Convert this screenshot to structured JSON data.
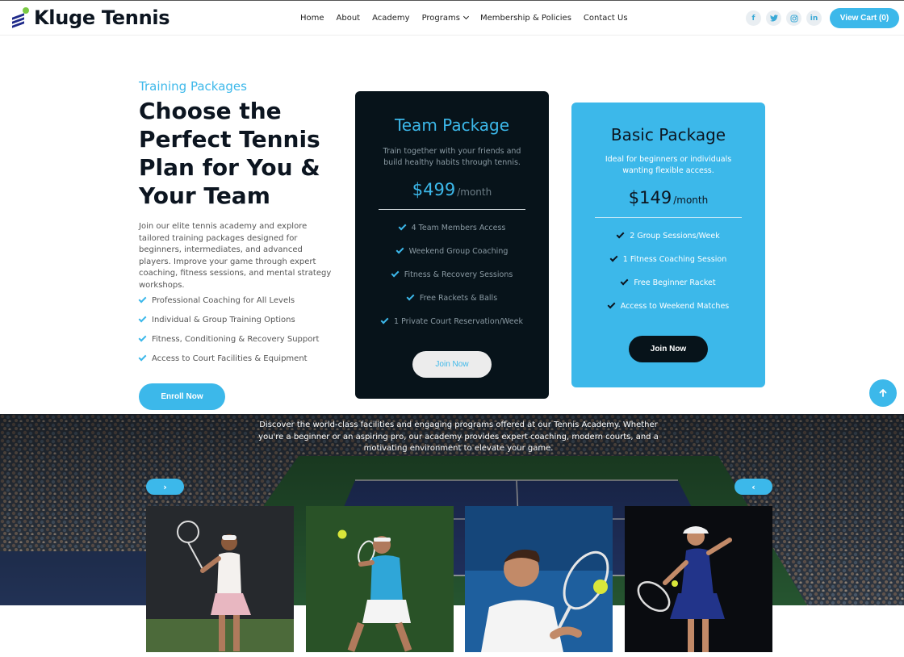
{
  "header": {
    "brand": "Kluge Tennis",
    "nav": [
      {
        "label": "Home"
      },
      {
        "label": "About"
      },
      {
        "label": "Academy"
      },
      {
        "label": "Programs"
      },
      {
        "label": "Membership & Policies"
      },
      {
        "label": "Contact Us"
      }
    ],
    "socials": [
      {
        "icon": "facebook-icon",
        "glyph": "f"
      },
      {
        "icon": "twitter-icon",
        "glyph": "t"
      },
      {
        "icon": "instagram-icon",
        "glyph": "◎"
      },
      {
        "icon": "linkedin-icon",
        "glyph": "in"
      }
    ],
    "cart_label": "View Cart (0)"
  },
  "intro": {
    "eyebrow": "Training Packages",
    "headline": "Choose the Perfect Tennis Plan for You & Your Team",
    "description": "Join our elite tennis academy and explore tailored training packages designed for beginners, intermediates, and advanced players. Improve your game through expert coaching, fitness sessions, and mental strategy workshops.",
    "checklist": [
      "Professional Coaching for All Levels",
      "Individual & Group Training Options",
      "Fitness, Conditioning & Recovery Support",
      "Access to Court Facilities & Equipment"
    ],
    "enroll_label": "Enroll Now"
  },
  "packages": [
    {
      "title": "Team Package",
      "description": "Train together with your friends and build healthy habits through tennis.",
      "price": "$499",
      "period": "/month",
      "features": [
        "4 Team Members Access",
        "Weekend Group Coaching",
        "Fitness & Recovery Sessions",
        "Free Rackets & Balls",
        "1 Private Court Reservation/Week"
      ],
      "cta": "Join Now"
    },
    {
      "title": "Basic Package",
      "description": "Ideal for beginners or individuals wanting flexible access.",
      "price": "$149",
      "period": "/month",
      "features": [
        "2 Group Sessions/Week",
        "1 Fitness Coaching Session",
        "Free Beginner Racket",
        "Access to Weekend Matches"
      ],
      "cta": "Join Now"
    }
  ],
  "banner": {
    "text": "Discover the world-class facilities and engaging programs offered at our Tennis Academy. Whether you're a beginner or an aspiring pro, our academy provides expert coaching, modern courts, and a motivating environment to elevate your game."
  },
  "carousel": {
    "next_glyph": "›",
    "prev_glyph": "‹"
  },
  "colors": {
    "accent": "#3cb8ea",
    "dark": "#07131a"
  }
}
